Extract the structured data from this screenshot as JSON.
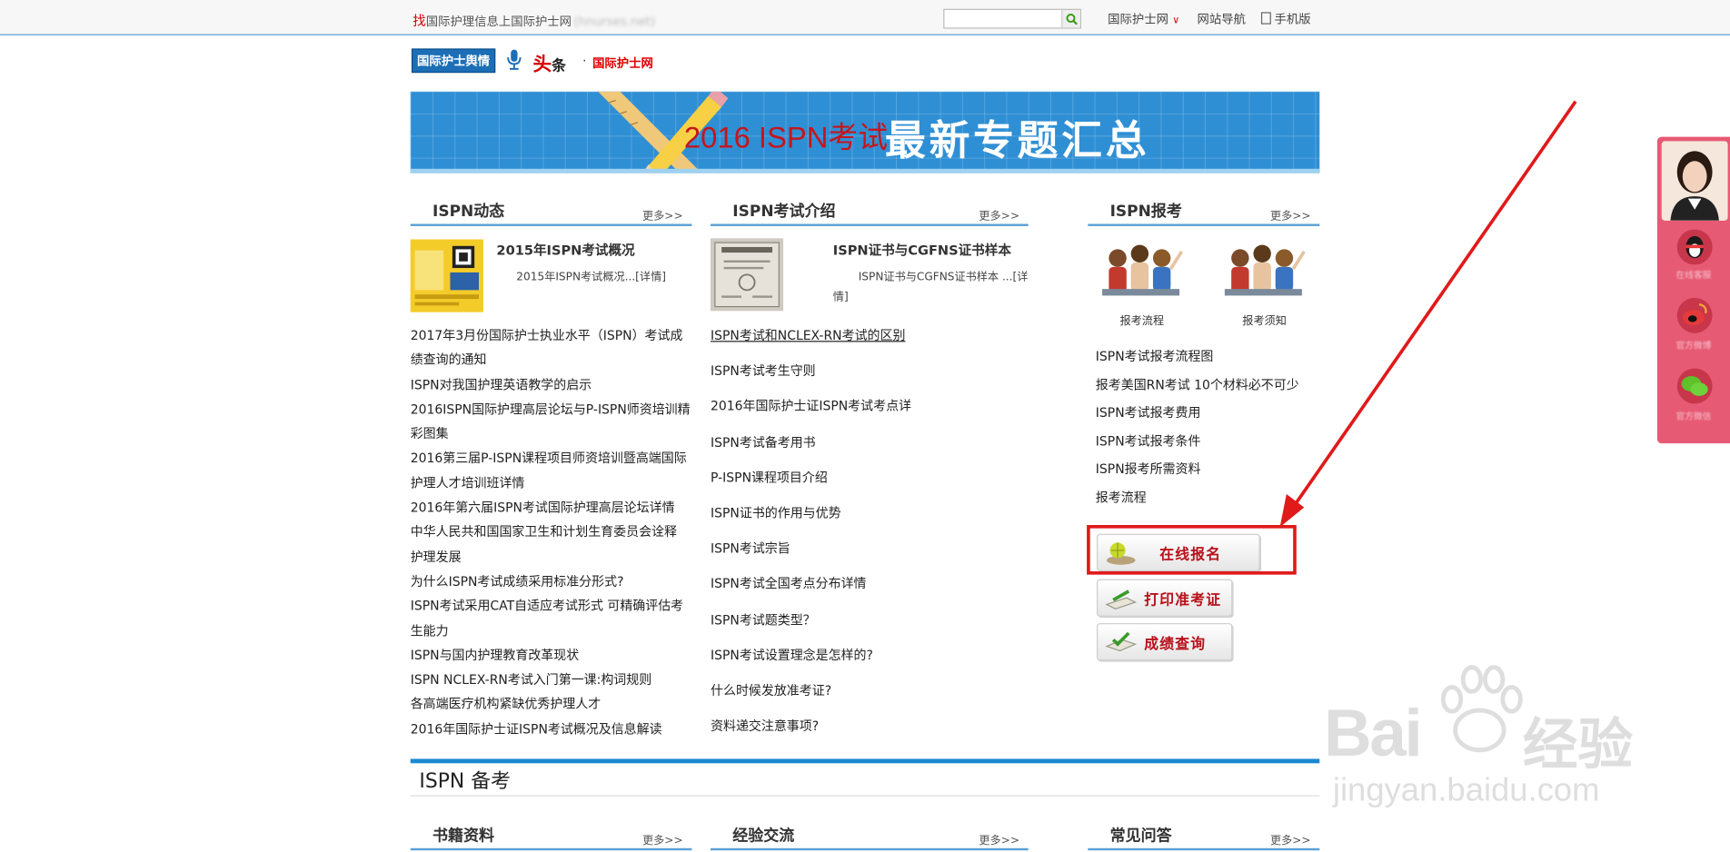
{
  "topbar": {
    "slogan_highlight": "找",
    "slogan_text": "国际护理信息上国际护士网",
    "slogan_blurred": "(hnurses.net)",
    "search_placeholder": "",
    "menu_site": "国际护士网",
    "menu_nav": "网站导航",
    "menu_mobile": "手机版"
  },
  "logo_row": {
    "badge": "国际护士舆情",
    "toutiao_big": "头",
    "toutiao_small": "条",
    "dot": "·",
    "brand": "国际护士网"
  },
  "banner": {
    "title_red": "2016 ISPN考试",
    "title_white": "最新专题汇总"
  },
  "col1": {
    "title": "ISPN动态",
    "more": "更多>>",
    "feature_title": "2015年ISPN考试概况",
    "feature_desc": "2015年ISPN考试概况...[详情]",
    "items": [
      "2017年3月份国际护士执业水平（ISPN）考试成",
      "绩查询的通知",
      "ISPN对我国护理英语教学的启示",
      "2016ISPN国际护理高层论坛与P-ISPN师资培训精",
      "彩图集",
      "2016第三届P-ISPN课程项目师资培训暨高端国际",
      "护理人才培训班详情",
      "2016年第六届ISPN考试国际护理高层论坛详情",
      "中华人民共和国国家卫生和计划生育委员会诠释",
      "护理发展",
      "为什么ISPN考试成绩采用标准分形式?",
      "ISPN考试采用CAT自适应考试形式 可精确评估考",
      "生能力",
      "ISPN与国内护理教育改革现状",
      "ISPN NCLEX-RN考试入门第一课:构词规则",
      "各高端医疗机构紧缺优秀护理人才",
      "2016年国际护士证ISPN考试概况及信息解读"
    ]
  },
  "col2": {
    "title": "ISPN考试介绍",
    "more": "更多>>",
    "feature_title": "ISPN证书与CGFNS证书样本",
    "feature_desc_1": "ISPN证书与CGFNS证书样本 ...[详",
    "feature_desc_2": "情]",
    "items": [
      "ISPN考试和NCLEX-RN考试的区别",
      "ISPN考试考生守则",
      "2016年国际护士证ISPN考试考点详",
      "ISPN考试备考用书",
      "P-ISPN课程项目介绍",
      "ISPN证书的作用与优势",
      "ISPN考试宗旨",
      "ISPN考试全国考点分布详情",
      "ISPN考试题类型？",
      "ISPN考试设置理念是怎样的?",
      "什么时候发放准考证?",
      "资料递交注意事项?"
    ]
  },
  "col3": {
    "title": "ISPN报考",
    "more": "更多>>",
    "caption_left": "报考流程",
    "caption_right": "报考须知",
    "items": [
      "ISPN考试报考流程图",
      "报考美国RN考试 10个材料必不可少",
      "ISPN考试报考费用",
      "ISPN考试报考条件",
      "ISPN报考所需资料",
      "报考流程"
    ],
    "btn_register": "在线报名",
    "btn_print": "打印准考证",
    "btn_score": "成绩查询"
  },
  "beikao": {
    "heading": "ISPN 备考",
    "sec1": "书籍资料",
    "sec2": "经验交流",
    "sec3": "常见问答",
    "more": "更多>>"
  },
  "float_bar": {
    "cap1": "在线客服",
    "cap2": "官方微博",
    "cap3": "官方微信"
  },
  "watermark": {
    "logo": "Bai",
    "logo2": "经验",
    "url": "jingyan.baidu.com"
  }
}
